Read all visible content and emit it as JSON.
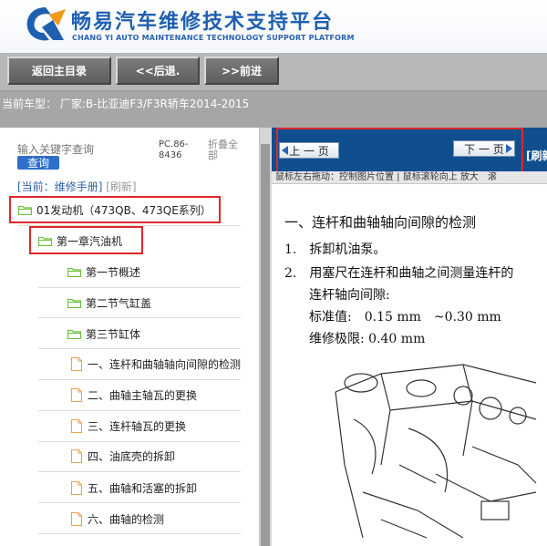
{
  "header": {
    "title_cn": "畅易汽车维修技术支持平台",
    "title_en": "CHANG YI AUTO MAINTENANCE TECHNOLOGY SUPPORT PLATFORM"
  },
  "toolbar": {
    "home_label": "返回主目录",
    "back_label": "<<后退.",
    "forward_label": ">>前进"
  },
  "model_bar": {
    "text": "当前车型： 厂家:B-比亚迪F3/F3R轿车2014-2015"
  },
  "left_pane": {
    "search_placeholder": "输入关键字查询",
    "search_button": "查询",
    "pc_code": "PC.86-8436",
    "collapse_all": "折叠全部",
    "current_prefix": "[当前：",
    "current_value": "维修手册",
    "current_suffix": "]",
    "refresh": "[刷新]",
    "tree": [
      {
        "label": "01发动机（473QB、473QE系列）",
        "type": "folder"
      },
      {
        "label": "第一章汽油机",
        "type": "folder"
      },
      {
        "label": "第一节概述",
        "type": "folder"
      },
      {
        "label": "第二节气缸盖",
        "type": "folder"
      },
      {
        "label": "第三节缸体",
        "type": "folder"
      },
      {
        "label": "一、连杆和曲轴轴向间隙的检测",
        "type": "doc"
      },
      {
        "label": "二、曲轴主轴瓦的更换",
        "type": "doc"
      },
      {
        "label": "三、连杆轴瓦的更换",
        "type": "doc"
      },
      {
        "label": "四、油底壳的拆卸",
        "type": "doc"
      },
      {
        "label": "五、曲轴和活塞的拆卸",
        "type": "doc"
      },
      {
        "label": "六、曲轴的检测",
        "type": "doc"
      }
    ]
  },
  "right_pane": {
    "prev_page": "上 一 页",
    "next_page": "下 一 页",
    "refresh": "[刷新",
    "hint": "鼠标左右拖动：控制图片位置 | 鼠标滚轮向上 放大　滚",
    "doc": {
      "heading": "一、连杆和曲轴轴向间隙的检测",
      "step1": "1.　拆卸机油泵。",
      "step2": "2.　用塞尺在连杆和曲轴之间测量连杆的",
      "step2_cont": "连杆轴向间隙:",
      "standard": "标准值:　0.15 mm　~0.30 mm",
      "limit": "维修极限:  0.40 mm"
    }
  },
  "colors": {
    "brand_blue": "#1f5fb0",
    "nav_blue": "#104f8e",
    "highlight_red": "#e0262a",
    "folder_green": "#6abf3a",
    "doc_orange": "#f1a04a"
  }
}
